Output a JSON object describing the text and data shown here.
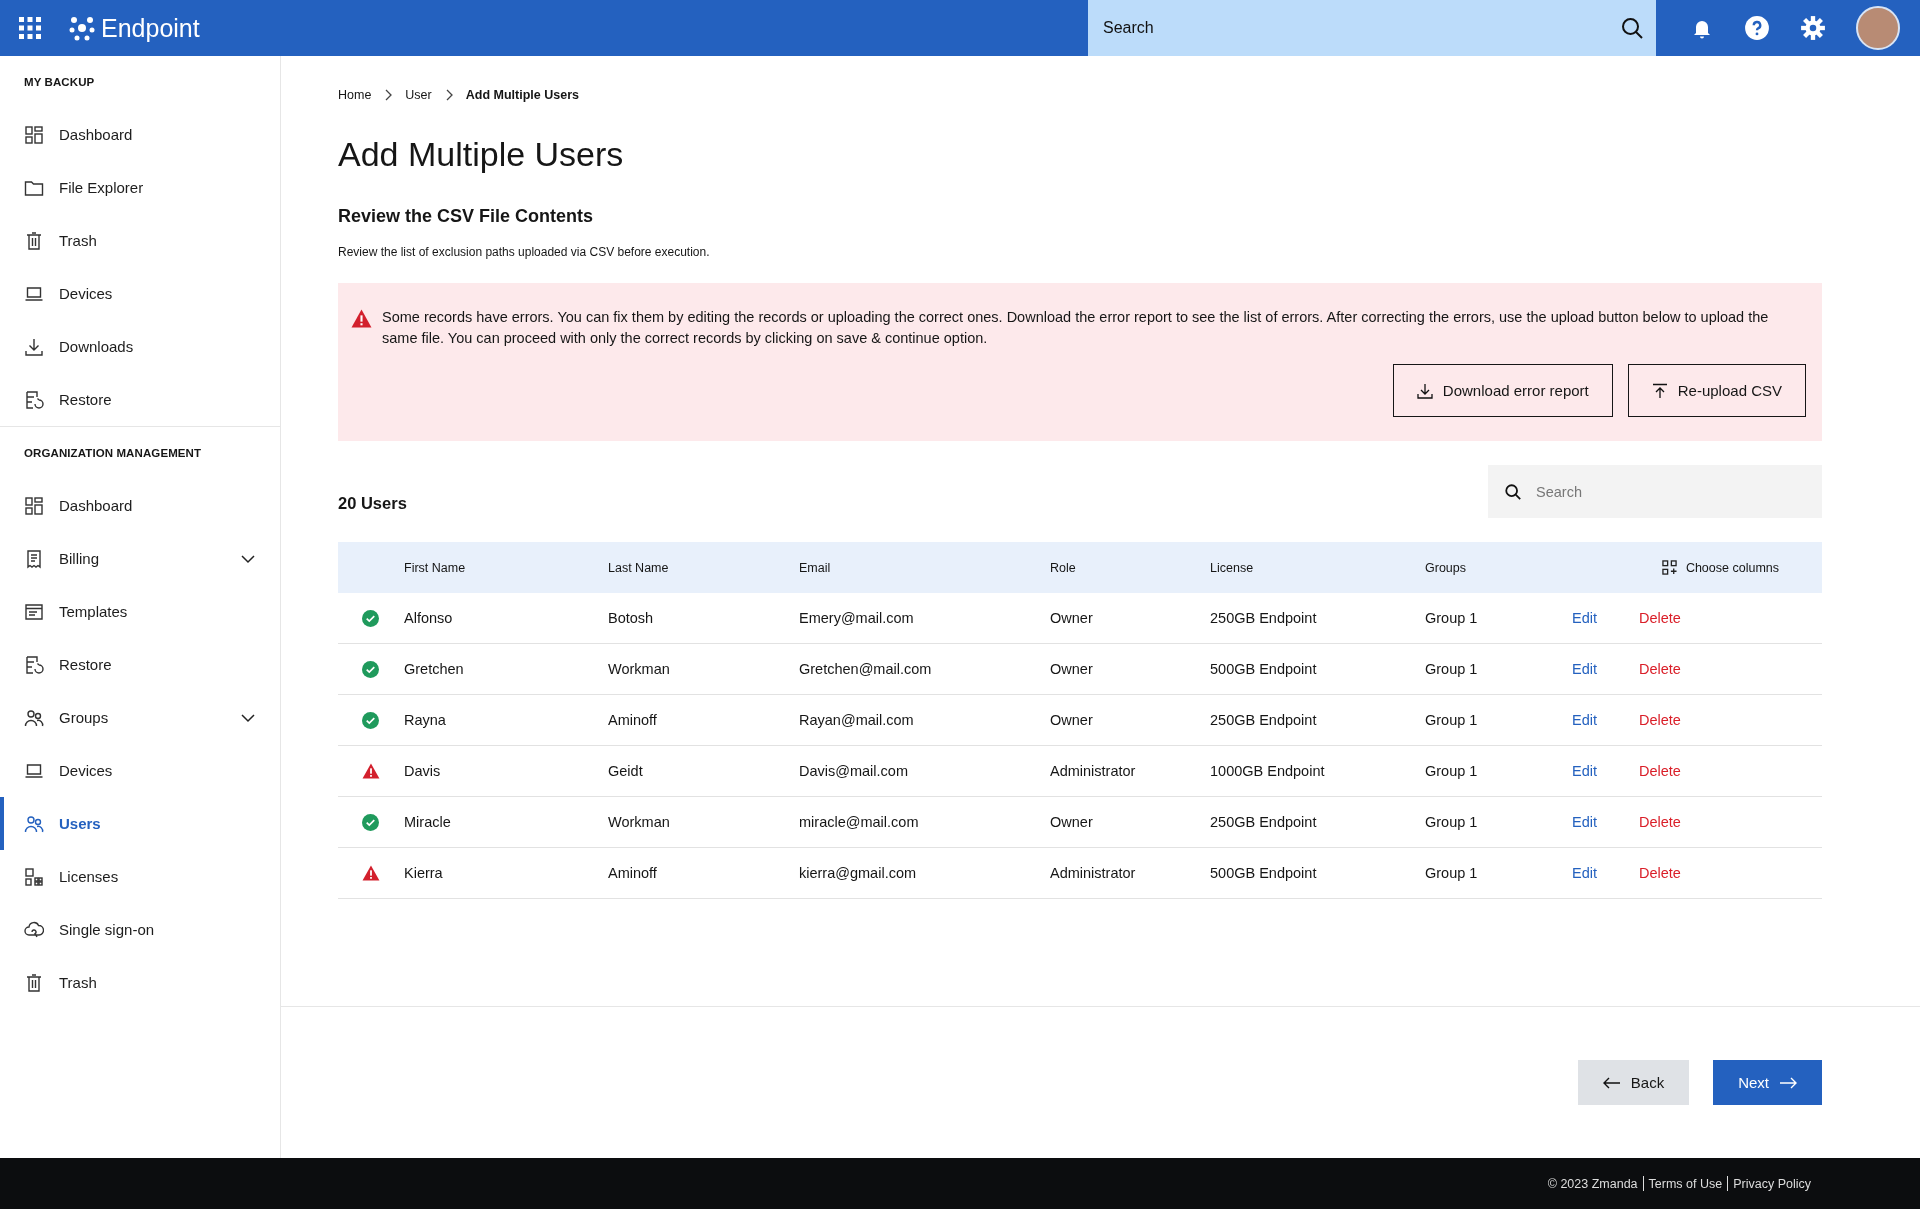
{
  "header": {
    "app_name": "Endpoint",
    "search": {
      "placeholder": "Search"
    }
  },
  "sidebar": {
    "sections": [
      {
        "title": "MY BACKUP",
        "items": [
          {
            "label": "Dashboard",
            "selected": false
          },
          {
            "label": "File Explorer",
            "selected": false
          },
          {
            "label": "Trash",
            "selected": false
          },
          {
            "label": "Devices",
            "selected": false
          },
          {
            "label": "Downloads",
            "selected": false
          },
          {
            "label": "Restore",
            "selected": false
          }
        ]
      },
      {
        "title": "ORGANIZATION MANAGEMENT",
        "items": [
          {
            "label": "Dashboard",
            "selected": false
          },
          {
            "label": "Billing",
            "selected": false,
            "expanded": false
          },
          {
            "label": "Templates",
            "selected": false
          },
          {
            "label": "Restore",
            "selected": false
          },
          {
            "label": "Groups",
            "selected": false,
            "expanded": false
          },
          {
            "label": "Devices",
            "selected": false
          },
          {
            "label": "Users",
            "selected": true
          },
          {
            "label": "Licenses",
            "selected": false
          },
          {
            "label": "Single sign-on",
            "selected": false
          },
          {
            "label": "Trash",
            "selected": false
          }
        ]
      }
    ]
  },
  "breadcrumb": [
    "Home",
    "User",
    "Add Multiple Users"
  ],
  "page_title": "Add Multiple Users",
  "section_title": "Review the CSV File Contents",
  "section_description": "Review the list of exclusion paths uploaded via CSV before execution.",
  "error_banner": {
    "message": "Some records have errors. You can fix them by editing the records or uploading the correct ones. Download the error report to see the list of errors. After correcting the errors, use the upload button below to upload the same file. You can proceed with only the correct records by clicking on save & continue option.",
    "buttons": [
      "Download error report",
      "Re-upload CSV"
    ]
  },
  "users_count": "20 Users",
  "table_search": {
    "placeholder": "Search"
  },
  "table": {
    "columns": [
      "First Name",
      "Last Name",
      "Email",
      "Role",
      "License",
      "Groups"
    ],
    "choose_columns": "Choose columns",
    "rows": [
      {
        "kind": "valid",
        "cells": [
          "Alfonso",
          "Botosh",
          "Emery@mail.com",
          "Owner",
          "250GB Endpoint",
          "Group 1"
        ],
        "edit": "Edit",
        "delete": "Delete"
      },
      {
        "kind": "valid",
        "cells": [
          "Gretchen",
          "Workman",
          "Gretchen@mail.com",
          "Owner",
          "500GB Endpoint",
          "Group 1"
        ],
        "edit": "Edit",
        "delete": "Delete"
      },
      {
        "kind": "valid",
        "cells": [
          "Rayna",
          "Aminoff",
          "Rayan@mail.com",
          "Owner",
          "250GB Endpoint",
          "Group 1"
        ],
        "edit": "Edit",
        "delete": "Delete"
      },
      {
        "kind": "error",
        "cells": [
          "Davis",
          "Geidt",
          "Davis@mail.com",
          "Administrator",
          "1000GB Endpoint",
          "Group 1"
        ],
        "edit": "Edit",
        "delete": "Delete"
      },
      {
        "kind": "valid",
        "cells": [
          "Miracle",
          "Workman",
          "miracle@mail.com",
          "Owner",
          "250GB Endpoint",
          "Group 1"
        ],
        "edit": "Edit",
        "delete": "Delete"
      },
      {
        "kind": "error",
        "cells": [
          "Kierra",
          "Aminoff",
          "kierra@gmail.com",
          "Administrator",
          "500GB Endpoint",
          "Group 1"
        ],
        "edit": "Edit",
        "delete": "Delete"
      }
    ]
  },
  "nav_buttons": {
    "back": "Back",
    "next": "Next"
  },
  "footer": {
    "copyright": "© 2023 Zmanda",
    "links": [
      "Terms of Use",
      "Privacy Policy"
    ]
  }
}
